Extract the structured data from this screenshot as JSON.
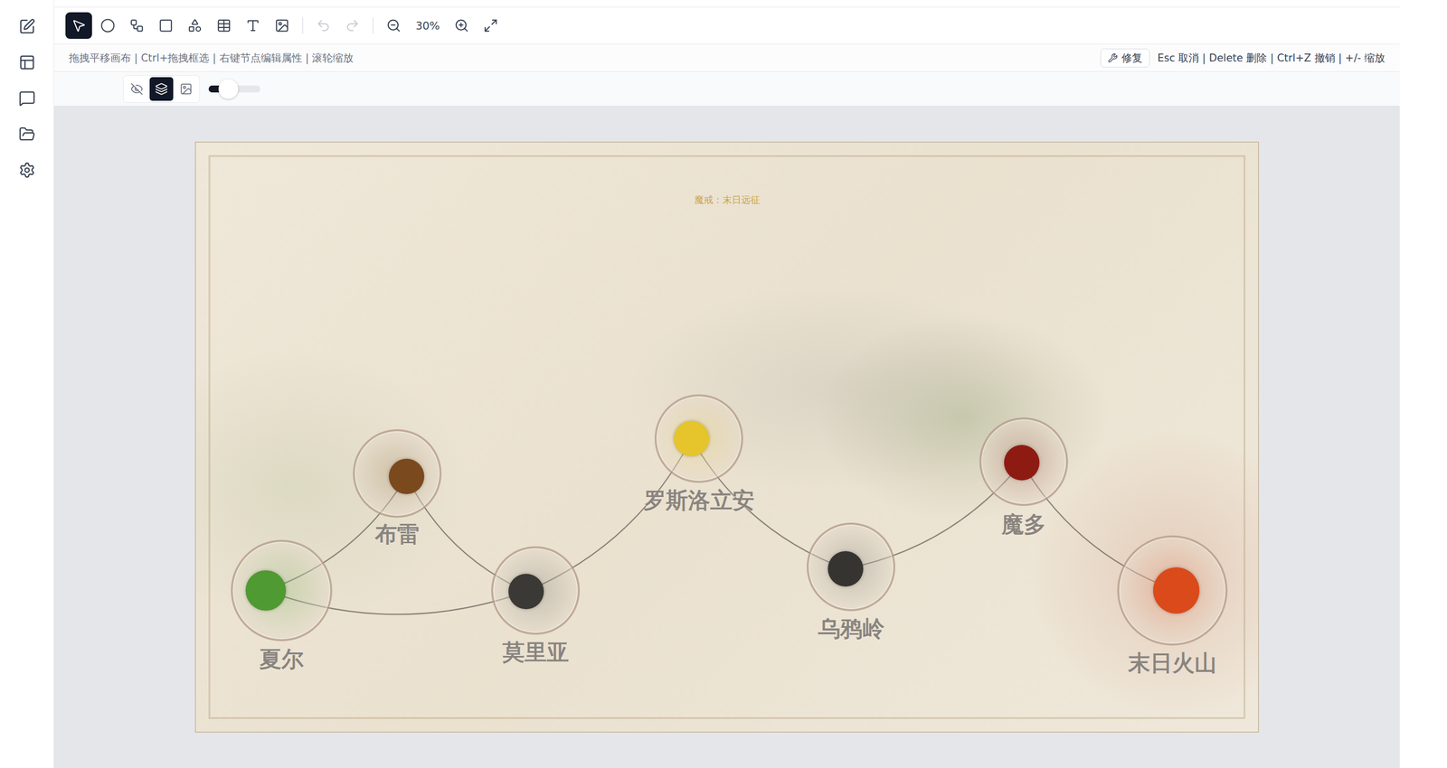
{
  "toolbar": {
    "tools": [
      {
        "selected": true
      },
      {
        "selected": false
      },
      {
        "selected": false
      },
      {
        "selected": false
      },
      {
        "selected": false
      },
      {
        "selected": false
      },
      {
        "selected": false
      },
      {
        "selected": false
      }
    ],
    "undo": {
      "disabled": true
    },
    "redo": {
      "disabled": true
    },
    "zoom": "30%"
  },
  "hints": {
    "text": "拖拽平移画布 | Ctrl+拖拽框选 | 右键节点编辑属性 | 滚轮缩放",
    "repair_button": "修复",
    "shortcuts": "Esc 取消 | Delete 删除 | Ctrl+Z 撤销 | +/- 缩放"
  },
  "layer_bar": {
    "buttons": [
      {
        "selected": false
      },
      {
        "selected": true
      },
      {
        "selected": false
      }
    ],
    "opacity": {
      "level": 0.38
    }
  },
  "map": {
    "title": "魔戒：末日远征",
    "nodes": [
      {
        "label": "夏尔",
        "color": "#4f9a32"
      },
      {
        "label": "布雷",
        "color": "#7a4a1e"
      },
      {
        "label": "莫里亚",
        "color": "#3b3936"
      },
      {
        "label": "罗斯洛立安",
        "color": "#e6c42c"
      },
      {
        "label": "乌鸦岭",
        "color": "#363431"
      },
      {
        "label": "魔多",
        "color": "#8e1b12"
      },
      {
        "label": "末日火山",
        "color": "#db4a1a"
      }
    ],
    "edges": [
      {
        "from": 0,
        "to": 1
      },
      {
        "from": 0,
        "to": 2
      },
      {
        "from": 1,
        "to": 2
      },
      {
        "from": 2,
        "to": 3
      },
      {
        "from": 3,
        "to": 4
      },
      {
        "from": 4,
        "to": 5
      },
      {
        "from": 5,
        "to": 6
      }
    ]
  }
}
